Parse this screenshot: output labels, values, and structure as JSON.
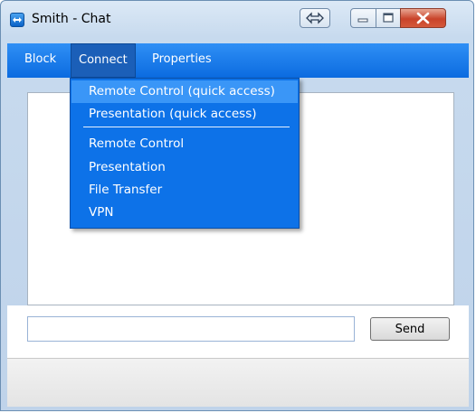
{
  "window": {
    "title": "Smith - Chat"
  },
  "menu": {
    "items": [
      {
        "label": "Block"
      },
      {
        "label": "Connect"
      },
      {
        "label": "Properties"
      }
    ]
  },
  "connect_menu": {
    "quick_items": [
      {
        "label": "Remote Control (quick access)"
      },
      {
        "label": "Presentation (quick access)"
      }
    ],
    "items": [
      {
        "label": "Remote Control"
      },
      {
        "label": "Presentation"
      },
      {
        "label": "File Transfer"
      },
      {
        "label": "VPN"
      }
    ]
  },
  "composer": {
    "message_value": "",
    "send_label": "Send"
  },
  "colors": {
    "menubar": "#0b6be0",
    "dropdown": "#0d72e8",
    "highlight": "#3a96f7"
  }
}
